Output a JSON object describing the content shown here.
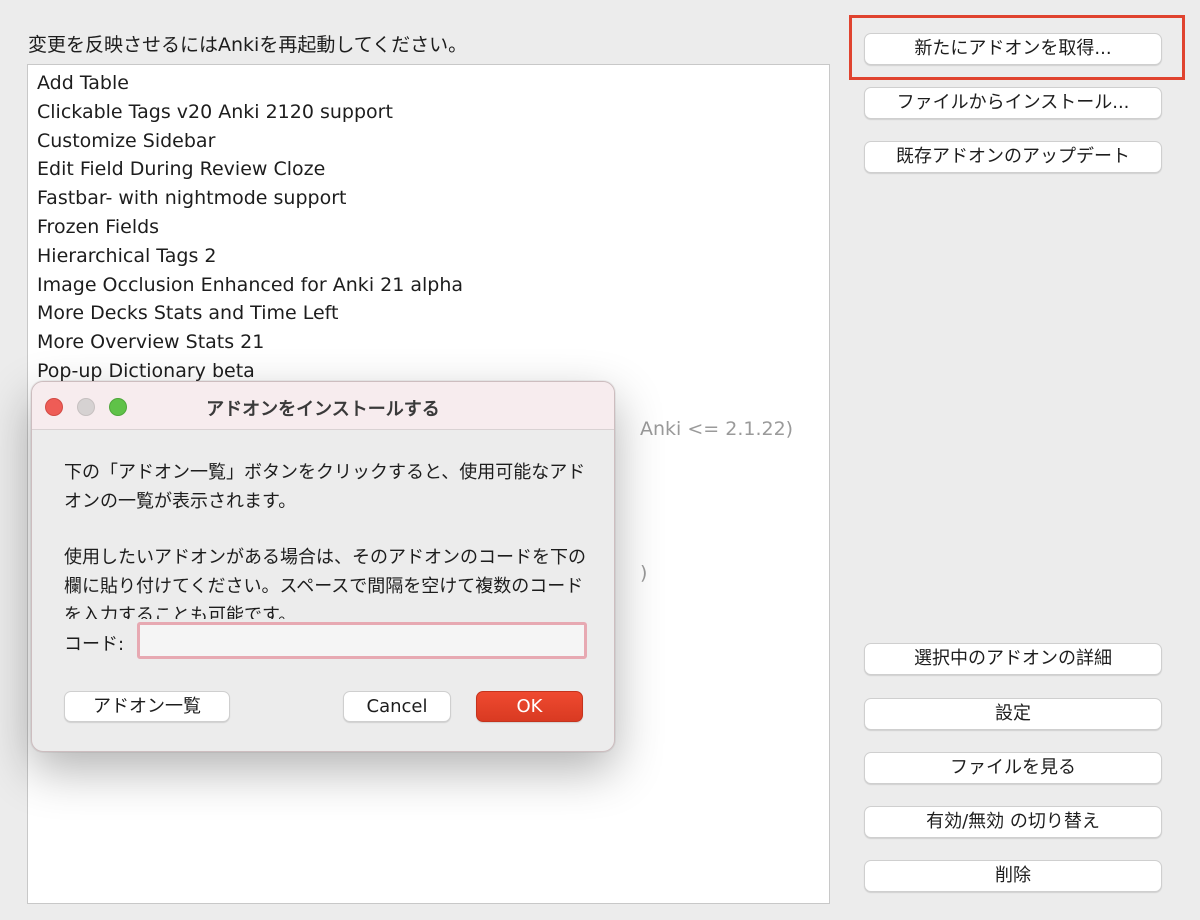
{
  "restart_note": "変更を反映させるにはAnkiを再起動してください。",
  "addons": [
    {
      "name": "Add Table",
      "disabled": false
    },
    {
      "name": "Clickable Tags v20 Anki 2120 support",
      "disabled": false
    },
    {
      "name": "Customize Sidebar",
      "disabled": false
    },
    {
      "name": "Edit Field During Review Cloze",
      "disabled": false
    },
    {
      "name": "Fastbar- with nightmode support",
      "disabled": false
    },
    {
      "name": "Frozen Fields",
      "disabled": false
    },
    {
      "name": "Hierarchical Tags 2",
      "disabled": false
    },
    {
      "name": "Image Occlusion Enhanced for Anki 21 alpha",
      "disabled": false
    },
    {
      "name": "More Decks Stats and Time Left",
      "disabled": false
    },
    {
      "name": "More Overview Stats 21",
      "disabled": false
    },
    {
      "name": "Pop-up Dictionary beta",
      "disabled": false
    },
    {
      "name": "",
      "disabled": false
    },
    {
      "name": "Anki <= 2.1.22)",
      "disabled": true
    },
    {
      "name": "",
      "disabled": false
    },
    {
      "name": "",
      "disabled": false
    },
    {
      "name": "",
      "disabled": false
    },
    {
      "name": "",
      "disabled": false
    },
    {
      "name": ")",
      "disabled": true
    }
  ],
  "side_buttons": {
    "get_new": "新たにアドオンを取得...",
    "install_from_file": "ファイルからインストール...",
    "check_updates": "既存アドオンのアップデート",
    "view_details": "選択中のアドオンの詳細",
    "config": "設定",
    "view_files": "ファイルを見る",
    "toggle_enabled": "有効/無効 の切り替え",
    "delete": "削除"
  },
  "dialog": {
    "title": "アドオンをインストールする",
    "description_1": "下の「アドオン一覧」ボタンをクリックすると、使用可能なアドオンの一覧が表示されます。",
    "description_2": "使用したいアドオンがある場合は、そのアドオンのコードを下の欄に貼り付けてください。スペースで間隔を空けて複数のコードを入力することも可能です。",
    "code_label": "コード:",
    "code_value": "",
    "code_placeholder": "",
    "browse_button": "アドオン一覧",
    "cancel_button": "Cancel",
    "ok_button": "OK"
  },
  "colors": {
    "highlight": "#e0432f",
    "ok_button": "#e5422a",
    "input_focus": "#e7a9b2"
  }
}
